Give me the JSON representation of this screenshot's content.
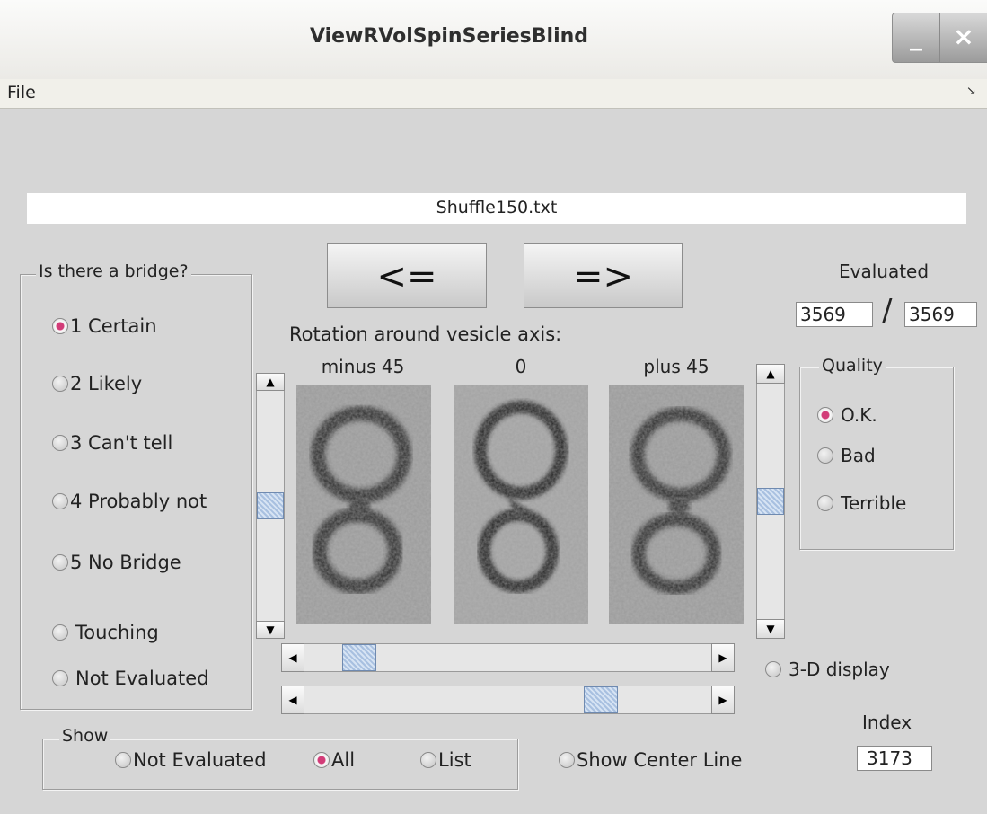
{
  "window": {
    "title": "ViewRVolSpinSeriesBlind",
    "minimize_glyph": "_",
    "close_glyph": "×"
  },
  "menu": {
    "file": "File",
    "corner_icon": "↘"
  },
  "filename": "Shuffle150.txt",
  "bridge": {
    "legend": "Is there a bridge?",
    "options": [
      "1  Certain",
      "2  Likely",
      "3  Can't tell",
      "4  Probably not",
      "5  No Bridge",
      "Touching",
      "Not Evaluated"
    ],
    "selected": "1  Certain"
  },
  "nav": {
    "prev": "<=",
    "next": "=>"
  },
  "rotation": {
    "caption": "Rotation around vesicle axis:",
    "views": [
      "minus 45",
      "0",
      "plus 45"
    ]
  },
  "evaluated": {
    "label": "Evaluated",
    "count": "3569",
    "separator": "/",
    "total": "3569"
  },
  "quality": {
    "legend": "Quality",
    "options": [
      "O.K.",
      "Bad",
      "Terrible"
    ],
    "selected": "O.K."
  },
  "display3d": "3-D display",
  "index": {
    "label": "Index",
    "value": "3173"
  },
  "show": {
    "legend": "Show",
    "options": [
      "Not Evaluated",
      "All",
      "List"
    ],
    "selected": "All"
  },
  "center_line": "Show Center Line",
  "scroll": {
    "left_slider": 0.5,
    "right_slider": 0.5,
    "h_top": 0.1,
    "h_bottom": 0.75
  },
  "colors": {
    "accent": "#d23c78",
    "thumb": "#a8c0e0"
  }
}
